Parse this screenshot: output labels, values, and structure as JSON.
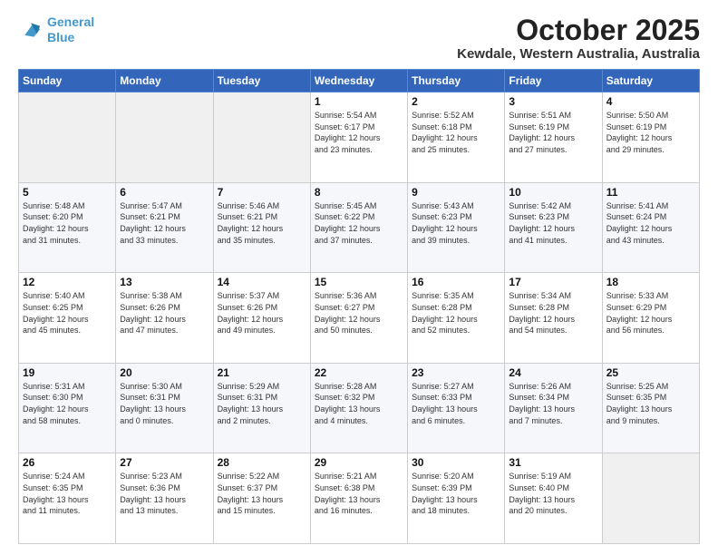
{
  "header": {
    "logo_line1": "General",
    "logo_line2": "Blue",
    "title": "October 2025",
    "subtitle": "Kewdale, Western Australia, Australia"
  },
  "weekdays": [
    "Sunday",
    "Monday",
    "Tuesday",
    "Wednesday",
    "Thursday",
    "Friday",
    "Saturday"
  ],
  "weeks": [
    [
      {
        "day": "",
        "info": ""
      },
      {
        "day": "",
        "info": ""
      },
      {
        "day": "",
        "info": ""
      },
      {
        "day": "1",
        "info": "Sunrise: 5:54 AM\nSunset: 6:17 PM\nDaylight: 12 hours\nand 23 minutes."
      },
      {
        "day": "2",
        "info": "Sunrise: 5:52 AM\nSunset: 6:18 PM\nDaylight: 12 hours\nand 25 minutes."
      },
      {
        "day": "3",
        "info": "Sunrise: 5:51 AM\nSunset: 6:19 PM\nDaylight: 12 hours\nand 27 minutes."
      },
      {
        "day": "4",
        "info": "Sunrise: 5:50 AM\nSunset: 6:19 PM\nDaylight: 12 hours\nand 29 minutes."
      }
    ],
    [
      {
        "day": "5",
        "info": "Sunrise: 5:48 AM\nSunset: 6:20 PM\nDaylight: 12 hours\nand 31 minutes."
      },
      {
        "day": "6",
        "info": "Sunrise: 5:47 AM\nSunset: 6:21 PM\nDaylight: 12 hours\nand 33 minutes."
      },
      {
        "day": "7",
        "info": "Sunrise: 5:46 AM\nSunset: 6:21 PM\nDaylight: 12 hours\nand 35 minutes."
      },
      {
        "day": "8",
        "info": "Sunrise: 5:45 AM\nSunset: 6:22 PM\nDaylight: 12 hours\nand 37 minutes."
      },
      {
        "day": "9",
        "info": "Sunrise: 5:43 AM\nSunset: 6:23 PM\nDaylight: 12 hours\nand 39 minutes."
      },
      {
        "day": "10",
        "info": "Sunrise: 5:42 AM\nSunset: 6:23 PM\nDaylight: 12 hours\nand 41 minutes."
      },
      {
        "day": "11",
        "info": "Sunrise: 5:41 AM\nSunset: 6:24 PM\nDaylight: 12 hours\nand 43 minutes."
      }
    ],
    [
      {
        "day": "12",
        "info": "Sunrise: 5:40 AM\nSunset: 6:25 PM\nDaylight: 12 hours\nand 45 minutes."
      },
      {
        "day": "13",
        "info": "Sunrise: 5:38 AM\nSunset: 6:26 PM\nDaylight: 12 hours\nand 47 minutes."
      },
      {
        "day": "14",
        "info": "Sunrise: 5:37 AM\nSunset: 6:26 PM\nDaylight: 12 hours\nand 49 minutes."
      },
      {
        "day": "15",
        "info": "Sunrise: 5:36 AM\nSunset: 6:27 PM\nDaylight: 12 hours\nand 50 minutes."
      },
      {
        "day": "16",
        "info": "Sunrise: 5:35 AM\nSunset: 6:28 PM\nDaylight: 12 hours\nand 52 minutes."
      },
      {
        "day": "17",
        "info": "Sunrise: 5:34 AM\nSunset: 6:28 PM\nDaylight: 12 hours\nand 54 minutes."
      },
      {
        "day": "18",
        "info": "Sunrise: 5:33 AM\nSunset: 6:29 PM\nDaylight: 12 hours\nand 56 minutes."
      }
    ],
    [
      {
        "day": "19",
        "info": "Sunrise: 5:31 AM\nSunset: 6:30 PM\nDaylight: 12 hours\nand 58 minutes."
      },
      {
        "day": "20",
        "info": "Sunrise: 5:30 AM\nSunset: 6:31 PM\nDaylight: 13 hours\nand 0 minutes."
      },
      {
        "day": "21",
        "info": "Sunrise: 5:29 AM\nSunset: 6:31 PM\nDaylight: 13 hours\nand 2 minutes."
      },
      {
        "day": "22",
        "info": "Sunrise: 5:28 AM\nSunset: 6:32 PM\nDaylight: 13 hours\nand 4 minutes."
      },
      {
        "day": "23",
        "info": "Sunrise: 5:27 AM\nSunset: 6:33 PM\nDaylight: 13 hours\nand 6 minutes."
      },
      {
        "day": "24",
        "info": "Sunrise: 5:26 AM\nSunset: 6:34 PM\nDaylight: 13 hours\nand 7 minutes."
      },
      {
        "day": "25",
        "info": "Sunrise: 5:25 AM\nSunset: 6:35 PM\nDaylight: 13 hours\nand 9 minutes."
      }
    ],
    [
      {
        "day": "26",
        "info": "Sunrise: 5:24 AM\nSunset: 6:35 PM\nDaylight: 13 hours\nand 11 minutes."
      },
      {
        "day": "27",
        "info": "Sunrise: 5:23 AM\nSunset: 6:36 PM\nDaylight: 13 hours\nand 13 minutes."
      },
      {
        "day": "28",
        "info": "Sunrise: 5:22 AM\nSunset: 6:37 PM\nDaylight: 13 hours\nand 15 minutes."
      },
      {
        "day": "29",
        "info": "Sunrise: 5:21 AM\nSunset: 6:38 PM\nDaylight: 13 hours\nand 16 minutes."
      },
      {
        "day": "30",
        "info": "Sunrise: 5:20 AM\nSunset: 6:39 PM\nDaylight: 13 hours\nand 18 minutes."
      },
      {
        "day": "31",
        "info": "Sunrise: 5:19 AM\nSunset: 6:40 PM\nDaylight: 13 hours\nand 20 minutes."
      },
      {
        "day": "",
        "info": ""
      }
    ]
  ]
}
